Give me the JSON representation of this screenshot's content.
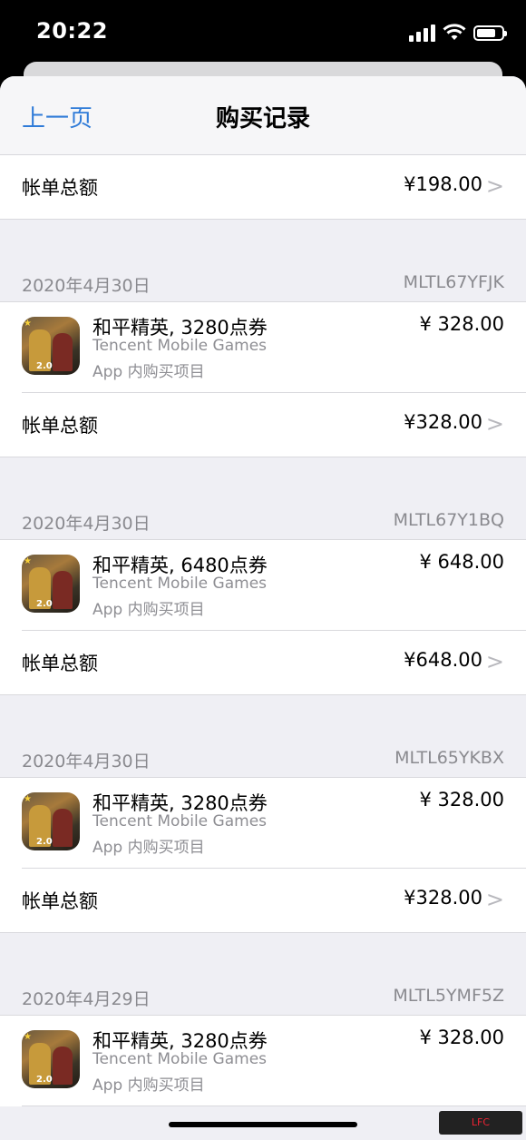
{
  "status_bar": {
    "time": "20:22"
  },
  "nav": {
    "back": "上一页",
    "title": "购买记录"
  },
  "first_total": {
    "label": "帐单总额",
    "amount": "¥198.00",
    "chevron": ">"
  },
  "orders": [
    {
      "date": "2020年4月30日",
      "order_id": "MLTL67YFJK",
      "item_title": "和平精英, 3280点券",
      "developer": "Tencent Mobile Games",
      "type": "App 内购买项目",
      "price": "¥ 328.00",
      "total_label": "帐单总额",
      "total": "¥328.00",
      "chevron": ">"
    },
    {
      "date": "2020年4月30日",
      "order_id": "MLTL67Y1BQ",
      "item_title": "和平精英, 6480点券",
      "developer": "Tencent Mobile Games",
      "type": "App 内购买项目",
      "price": "¥ 648.00",
      "total_label": "帐单总额",
      "total": "¥648.00",
      "chevron": ">"
    },
    {
      "date": "2020年4月30日",
      "order_id": "MLTL65YKBX",
      "item_title": "和平精英, 3280点券",
      "developer": "Tencent Mobile Games",
      "type": "App 内购买项目",
      "price": "¥ 328.00",
      "total_label": "帐单总额",
      "total": "¥328.00",
      "chevron": ">"
    },
    {
      "date": "2020年4月29日",
      "order_id": "MLTL5YMF5Z",
      "item_title": "和平精英, 3280点券",
      "developer": "Tencent Mobile Games",
      "type": "App 内购买项目",
      "price": "¥ 328.00"
    }
  ],
  "icons": {
    "app": "game-app-icon",
    "chevron": "chevron-right-icon"
  },
  "colors": {
    "link": "#2f7bd8",
    "secondary_text": "#8e8e93",
    "background": "#efeff4"
  }
}
